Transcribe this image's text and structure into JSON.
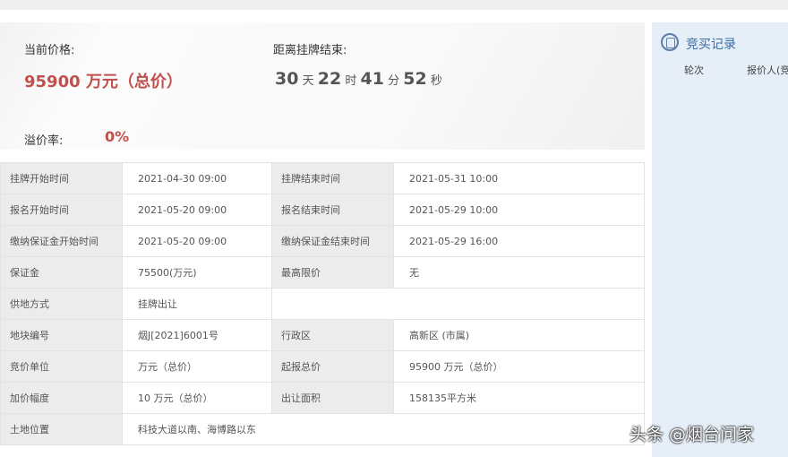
{
  "hero": {
    "price_label": "当前价格:",
    "price": "95900 万元（总价）",
    "countdown_label": "距离挂牌结束:",
    "days": "30",
    "days_u": "天",
    "hours": "22",
    "hours_u": "时",
    "minutes": "41",
    "minutes_u": "分",
    "seconds": "52",
    "seconds_u": "秒",
    "rate_label": "溢价率:",
    "rate": "0%"
  },
  "rows": [
    {
      "k1": "挂牌开始时间",
      "v1": "2021-04-30 09:00",
      "k2": "挂牌结束时间",
      "v2": "2021-05-31 10:00"
    },
    {
      "k1": "报名开始时间",
      "v1": "2021-05-20 09:00",
      "k2": "报名结束时间",
      "v2": "2021-05-29 10:00"
    },
    {
      "k1": "缴纳保证金开始时间",
      "v1": "2021-05-20 09:00",
      "k2": "缴纳保证金结束时间",
      "v2": "2021-05-29 16:00"
    },
    {
      "k1": "保证金",
      "v1": "75500(万元)",
      "k2": "最高限价",
      "v2": "无"
    },
    {
      "k1": "供地方式",
      "v1": "挂牌出让"
    },
    {
      "k1": "地块编号",
      "v1": "烟J[2021]6001号",
      "k2": "行政区",
      "v2": "高新区 (市属)"
    },
    {
      "k1": "竞价单位",
      "v1": "万元（总价）",
      "k2": "起报总价",
      "v2": "95900 万元（总价）"
    },
    {
      "k1": "加价幅度",
      "v1": "10 万元（总价）",
      "k2": "出让面积",
      "v2": "158135平方米"
    },
    {
      "k1": "土地位置",
      "v1": "科技大道以南、海博路以东"
    }
  ],
  "side": {
    "title": "竞买记录",
    "col1": "轮次",
    "col2": "报价人(竞"
  },
  "watermark": "头条 @烟台问家"
}
